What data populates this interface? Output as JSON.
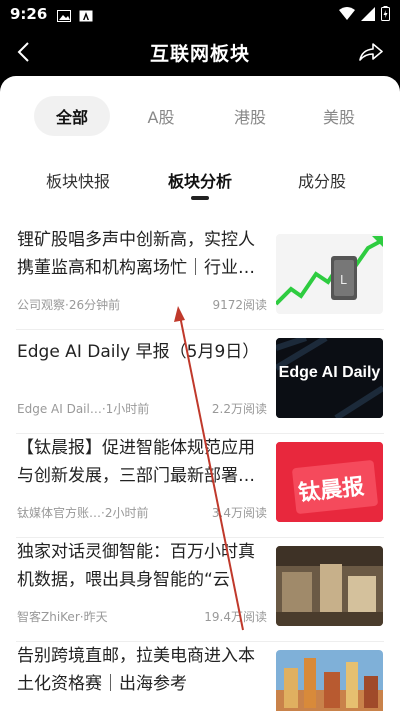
{
  "status": {
    "time": "9:26"
  },
  "header": {
    "title": "互联网板块"
  },
  "market_tabs": [
    {
      "label": "全部",
      "active": true
    },
    {
      "label": "A股",
      "active": false
    },
    {
      "label": "港股",
      "active": false
    },
    {
      "label": "美股",
      "active": false
    }
  ],
  "sub_tabs": [
    {
      "label": "板块快报",
      "active": false
    },
    {
      "label": "板块分析",
      "active": true
    },
    {
      "label": "成分股",
      "active": false
    }
  ],
  "news": [
    {
      "title": "锂矿股唱多声中创新高，实控人携董监高和机构离场忙｜行业…",
      "source": "公司观察·26分钟前",
      "reads": "9172阅读"
    },
    {
      "title": "Edge AI Daily 早报（5月9日）",
      "source": "Edge AI Dail…·1小时前",
      "reads": "2.2万阅读",
      "thumb_text": "Edge AI Daily"
    },
    {
      "title": "【钛晨报】促进智能体规范应用与创新发展，三部门最新部署…",
      "source": "钛媒体官方账…·2小时前",
      "reads": "3.4万阅读",
      "thumb_text": "钛晨报"
    },
    {
      "title": "独家对话灵御智能：百万小时真机数据，喂出具身智能的“云端…",
      "source": "智客ZhiKer·昨天",
      "reads": "19.4万阅读"
    },
    {
      "title": "告别跨境直邮，拉美电商进入本土化资格赛｜出海参考",
      "source": "",
      "reads": ""
    }
  ],
  "colors": {
    "accent": "#111111",
    "annotation_arrow": "#c0392b"
  }
}
